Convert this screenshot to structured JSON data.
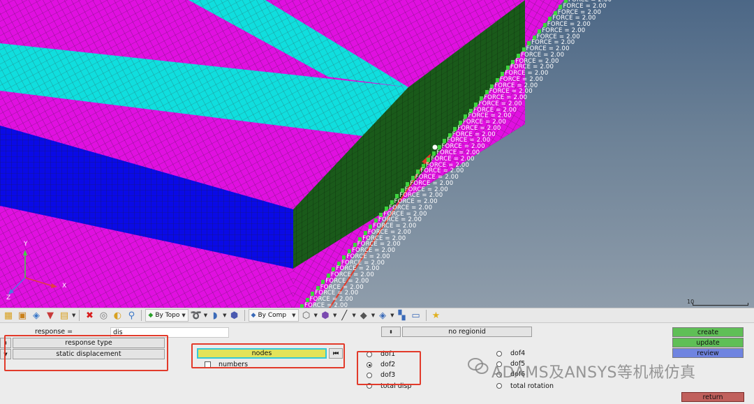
{
  "viewport": {
    "load_label": "FORCE = 2.00",
    "axes": {
      "x": "X",
      "y": "Y",
      "z": "Z"
    },
    "scale_label": "10"
  },
  "toolbar": {
    "icons": [
      "component-icon",
      "assembly-icon",
      "material-icon",
      "property-icon",
      "load-collector-icon",
      "delete-icon",
      "mask-icon",
      "find-icon",
      "tie-icon"
    ],
    "color_mode_1": "By Topo",
    "color_mode_2": "By Comp"
  },
  "panel": {
    "response_label": "response =",
    "response_value": "dis",
    "response_type_button": "response type",
    "response_type_value": "static displacement",
    "regionid_button": "no regionid",
    "nodes_button": "nodes",
    "numbers_label": "numbers",
    "dof_options": [
      {
        "label": "dof1",
        "selected": false
      },
      {
        "label": "dof2",
        "selected": true
      },
      {
        "label": "dof3",
        "selected": false
      },
      {
        "label": "total disp",
        "selected": false
      }
    ],
    "dof_options_right": [
      {
        "label": "dof4",
        "selected": false
      },
      {
        "label": "dof5",
        "selected": false
      },
      {
        "label": "dof6",
        "selected": false
      },
      {
        "label": "total rotation",
        "selected": false
      }
    ],
    "actions": {
      "create": "create",
      "update": "update",
      "review": "review",
      "return": "return"
    },
    "colors": {
      "create": "#5fbf56",
      "update": "#5fbf56",
      "review": "#6f84e0",
      "return": "#c0605c",
      "nodes": "#e3e35a"
    }
  },
  "watermark": "ADAMS及ANSYS等机械仿真"
}
